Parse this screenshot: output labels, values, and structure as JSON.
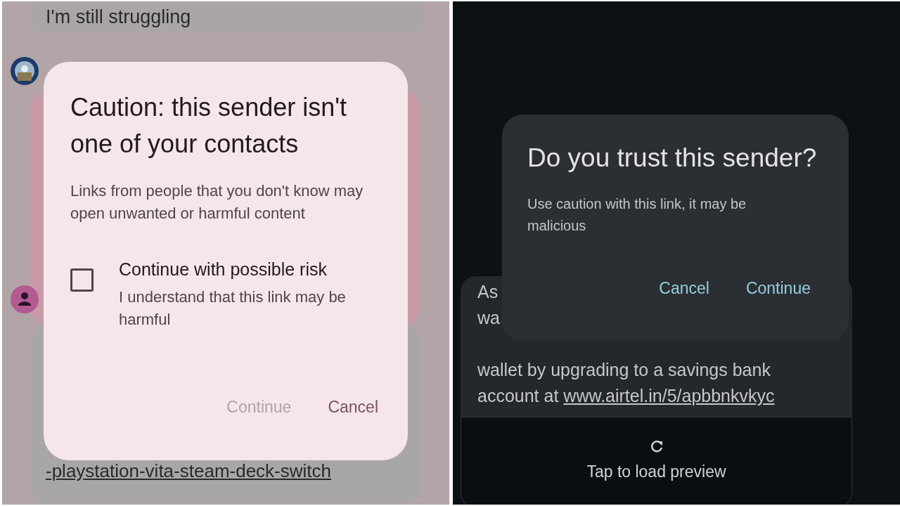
{
  "left_screen": {
    "top_message": "I'm still struggling",
    "link_message": "-playstation-vita-steam-deck-switch",
    "dialog": {
      "title": "Caution: this sender isn't one of your contacts",
      "body": "Links from people that you don't know may open unwanted or harmful content",
      "checkbox": {
        "label": "Continue with possible risk",
        "description": "I understand that this link may be harmful",
        "checked": false
      },
      "buttons": [
        {
          "label": "Continue",
          "disabled": true
        },
        {
          "label": "Cancel",
          "disabled": false
        }
      ]
    }
  },
  "right_screen": {
    "message_lines": [
      "As",
      "wa",
      "wallet by upgrading to a savings bank"
    ],
    "message_end": {
      "text": "account at",
      "link": "www.airtel.in/5/apbbnkvkyc"
    },
    "preview": {
      "label": "Tap to load preview"
    },
    "dialog": {
      "title": "Do you trust this sender?",
      "body": "Use caution with this link, it may be malicious",
      "buttons": [
        {
          "label": "Cancel",
          "disabled": false
        },
        {
          "label": "Continue",
          "disabled": false
        }
      ]
    }
  }
}
